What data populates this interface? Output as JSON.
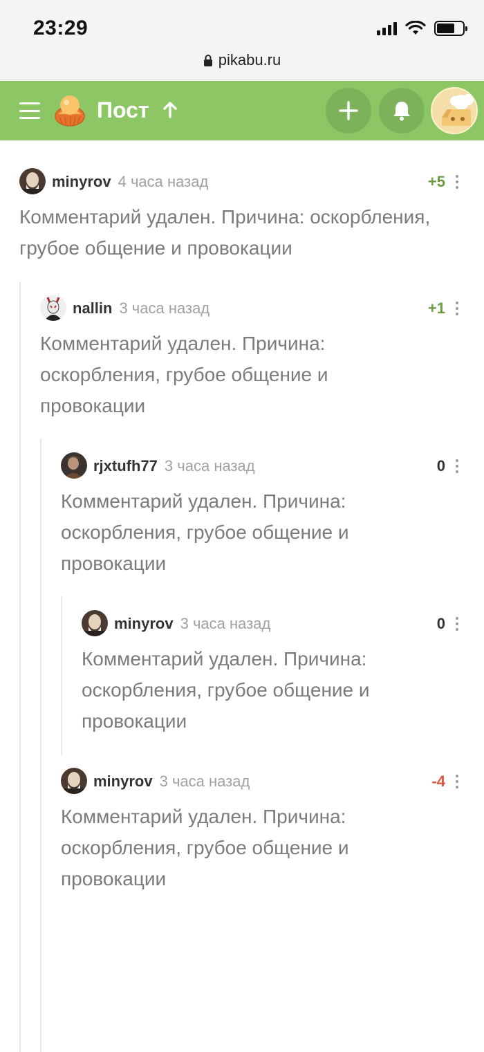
{
  "status_bar": {
    "time": "23:29",
    "url": "pikabu.ru"
  },
  "header": {
    "title": "Пост"
  },
  "comments": [
    {
      "user": "minyrov",
      "time": "4 часа назад",
      "rating": "+5",
      "text": "Комментарий удален. Причина: оскорбления, грубое общение и провокации"
    },
    {
      "user": "nallin",
      "time": "3 часа назад",
      "rating": "+1",
      "text": "Комментарий удален. Причина: оскорбления, грубое общение и провокации"
    },
    {
      "user": "rjxtufh77",
      "time": "3 часа назад",
      "rating": "0",
      "text": "Комментарий удален. Причина: оскорбления, грубое общение и провокации"
    },
    {
      "user": "minyrov",
      "time": "3 часа назад",
      "rating": "0",
      "text": "Комментарий удален. Причина: оскорбления, грубое общение и провокации"
    },
    {
      "user": "minyrov",
      "time": "3 часа назад",
      "rating": "-4",
      "text": "Комментарий удален. Причина: оскорбления, грубое общение и провокации"
    }
  ],
  "colors": {
    "header_bg": "#8dc765",
    "rating_positive": "#6c9a43",
    "rating_negative": "#d9563f",
    "text_muted": "#7b7b7b"
  },
  "icons": [
    "lock-icon",
    "menu-icon",
    "pikabu-logo-icon",
    "arrow-up-icon",
    "plus-icon",
    "bell-icon",
    "more-icon"
  ]
}
